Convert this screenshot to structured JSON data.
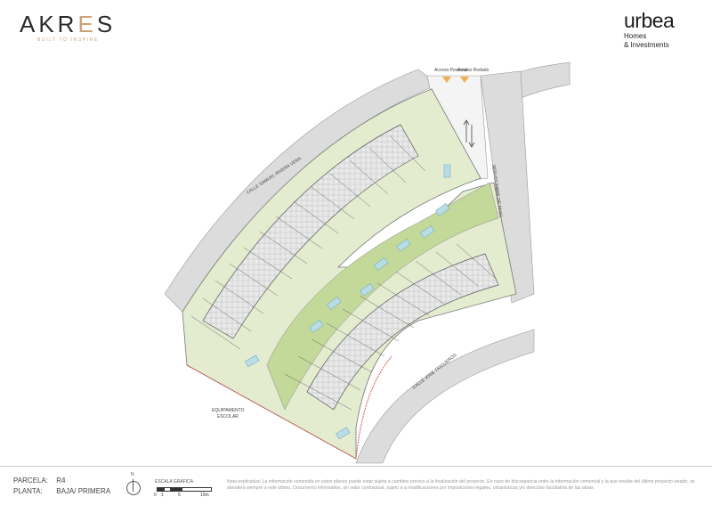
{
  "header": {
    "brand_left": {
      "pre": "AKR",
      "e": "E",
      "post": "S",
      "tagline": "BUILT TO INSPIRE"
    },
    "brand_right": {
      "name": "urbea",
      "line1": "Homes",
      "line2": "& Investments"
    }
  },
  "plan": {
    "street_north": "CALLE SAMUEL RIVERA VERA",
    "street_east": "SERVIDUMBRE DE PASO",
    "street_south": "CALLE JOSÉ TRIGUEROS",
    "facility_line1": "EQUIPAMENTO",
    "facility_line2": "ESCOLAR",
    "access_label_1": "Acceso Peatonal",
    "access_label_2": "Acceso Rodado",
    "colors": {
      "garden": "#dfeac6",
      "lawn": "#bcd690",
      "pool": "#b9dde7",
      "road": "#d9d9d9",
      "boundary": "#d9534f"
    }
  },
  "footer": {
    "parcela_label": "PARCELA:",
    "parcela_value": "R4",
    "planta_label": "PLANTA:",
    "planta_value": "BAJA/ PRIMERA",
    "north": "N",
    "scale_title": "ESCALA GRÁFICA",
    "scale_ticks": [
      "0",
      "1",
      "5",
      "10m"
    ],
    "note": "Nota explicativa: La información contenida en estos planos puede estar sujeta a cambios previos a la finalización del proyecto. En caso de discrepancia entre la información comercial y la que resulte del último proyecto visado, se atenderá siempre a este último. Documento informativo, sin valor contractual, sujeto a a modificaciones por imposiciones legales, urbanísticas y/o dirección facultativa de las obras."
  }
}
